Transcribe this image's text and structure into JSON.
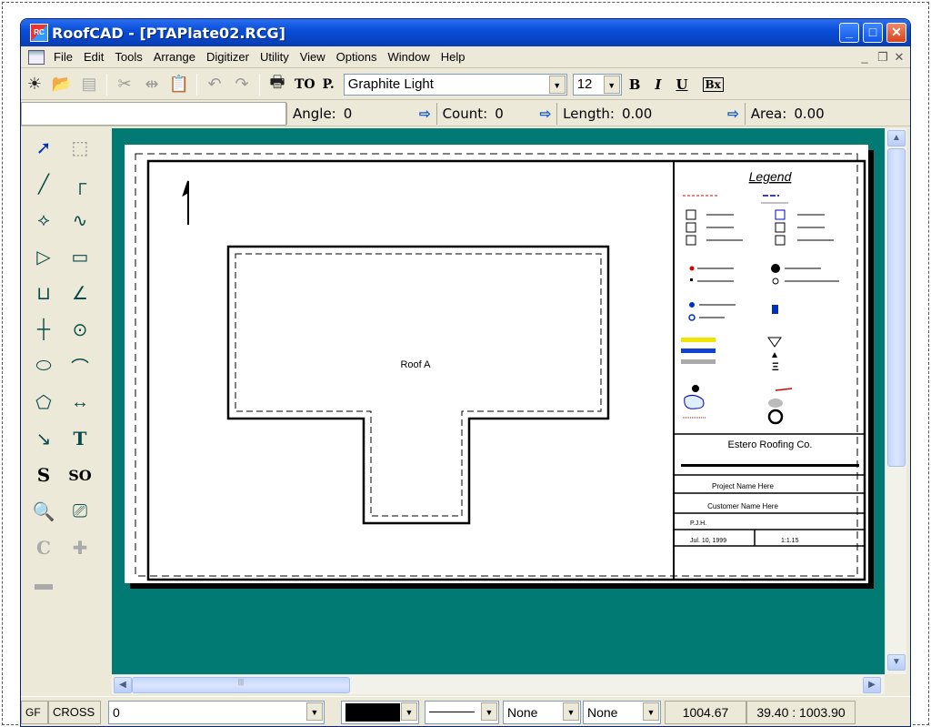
{
  "window": {
    "title": "RoofCAD - [PTAPlate02.RCG]",
    "icon_text": "RC"
  },
  "menu": [
    "File",
    "Edit",
    "Tools",
    "Arrange",
    "Digitizer",
    "Utility",
    "View",
    "Options",
    "Window",
    "Help"
  ],
  "toolbar": {
    "to_label": "TO",
    "p_label": "P.",
    "font": "Graphite Light",
    "size": "12",
    "bold": "B",
    "italic": "I",
    "underline": "U",
    "bx": "Bx"
  },
  "status": {
    "angle_label": "Angle:",
    "angle_value": "0",
    "count_label": "Count:",
    "count_value": "0",
    "length_label": "Length:",
    "length_value": "0.00",
    "area_label": "Area:",
    "area_value": "0.00"
  },
  "tools": {
    "s_label": "S",
    "so_label": "SO",
    "t_label": "T",
    "c_label": "C"
  },
  "drawing": {
    "roof_label": "Roof A",
    "legend_title": "Legend",
    "company": "Estero Roofing Co.",
    "project": "Project Name Here",
    "customer": "Customer Name Here",
    "drawn_by": "P.J.H.",
    "date": "Jul. 10, 1999",
    "scale": "1:1.15"
  },
  "bottombar": {
    "gf": "GF",
    "cross": "CROSS",
    "layer": "0",
    "none1": "None",
    "none2": "None",
    "coord1": "1004.67",
    "coord2": "39.40 : 1003.90"
  }
}
